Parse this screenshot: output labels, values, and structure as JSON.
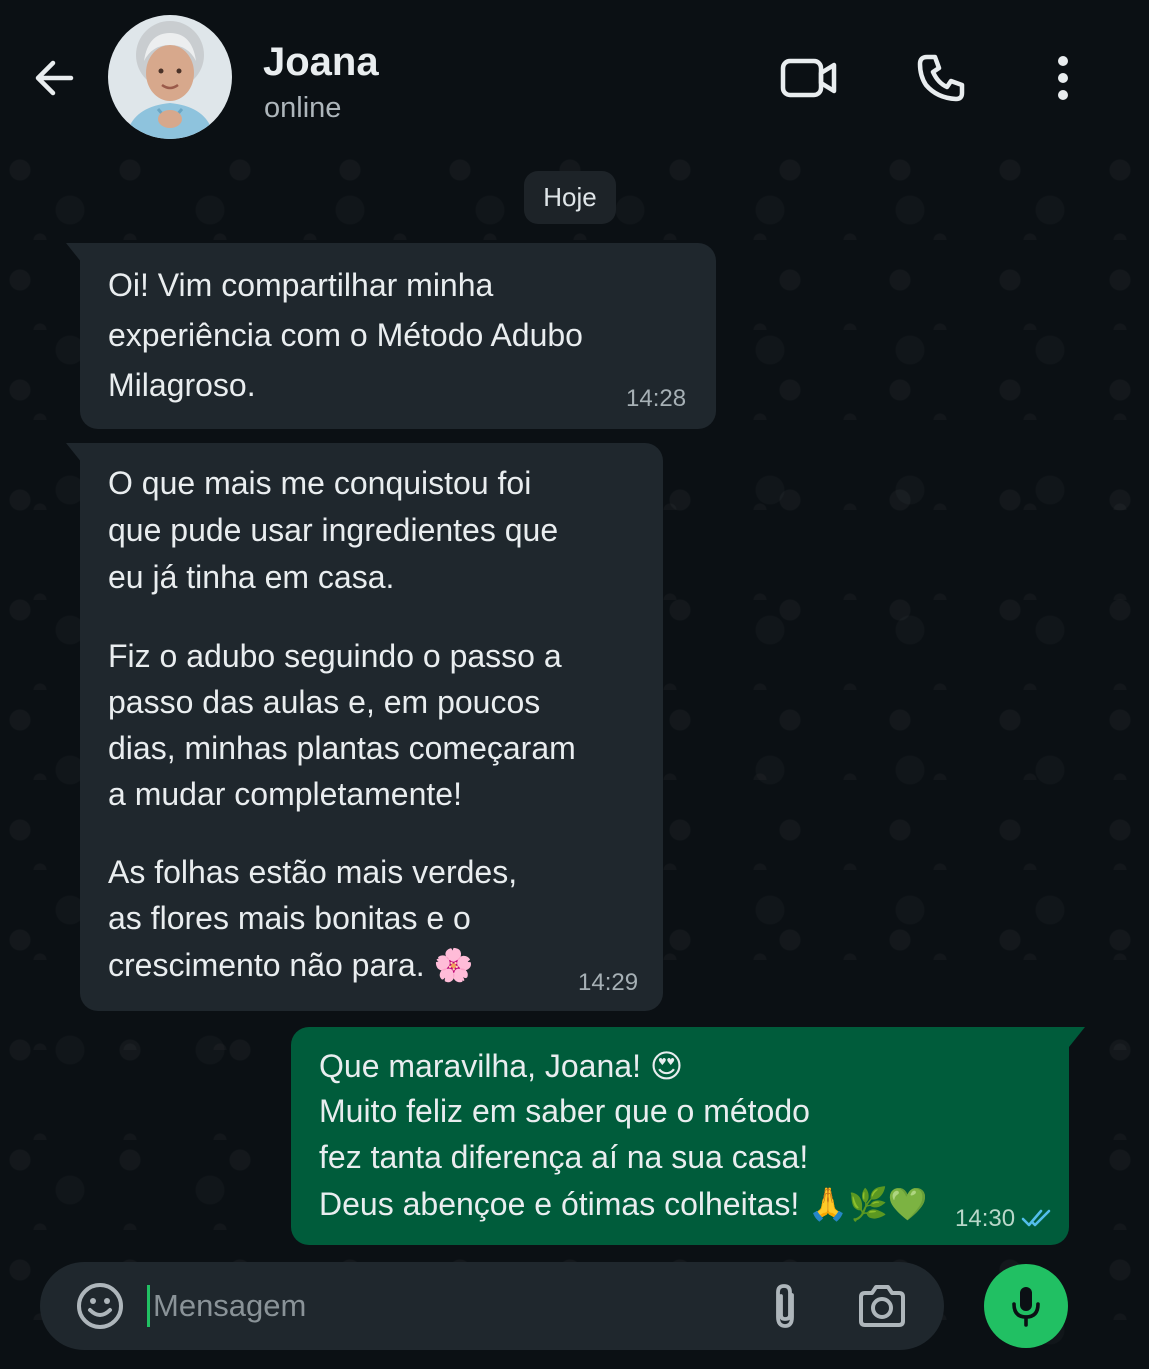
{
  "header": {
    "contact_name": "Joana",
    "status": "online",
    "back_icon": "arrow-left-icon",
    "video_icon": "video-camera-icon",
    "call_icon": "phone-icon",
    "menu_icon": "more-vertical-icon"
  },
  "chat": {
    "date_chip": "Hoje",
    "messages": [
      {
        "direction": "incoming",
        "lines": [
          "Oi! Vim compartilhar minha",
          "experiência com o Método Adubo",
          "Milagroso."
        ],
        "time": "14:28"
      },
      {
        "direction": "incoming",
        "paragraphs": [
          [
            "O que mais me conquistou foi",
            "que pude usar ingredientes que",
            "eu já tinha em casa."
          ],
          [
            "Fiz o adubo seguindo o passo a",
            "passo das aulas e, em poucos",
            "dias, minhas plantas começaram",
            "a mudar completamente!"
          ],
          [
            "As folhas estão mais verdes,",
            "as flores mais bonitas e o",
            "crescimento não para. 🌸"
          ]
        ],
        "time": "14:29"
      },
      {
        "direction": "outgoing",
        "lines": [
          "Que maravilha, Joana! 😍",
          "Muito feliz em saber que o método",
          "fez tanta diferença aí na sua casa!",
          "Deus abençoe e ótimas colheitas! 🙏🌿💚"
        ],
        "time": "14:30",
        "status_icon": "double-check-read-icon"
      }
    ]
  },
  "composer": {
    "placeholder": "Mensagem",
    "emoji_icon": "emoji-icon",
    "attach_icon": "paperclip-icon",
    "camera_icon": "camera-icon",
    "mic_icon": "microphone-icon"
  },
  "colors": {
    "background": "#0b1014",
    "incoming_bubble": "#1f272d",
    "outgoing_bubble": "#005c3b",
    "accent_green": "#21c063",
    "read_tick": "#53bdeb"
  }
}
